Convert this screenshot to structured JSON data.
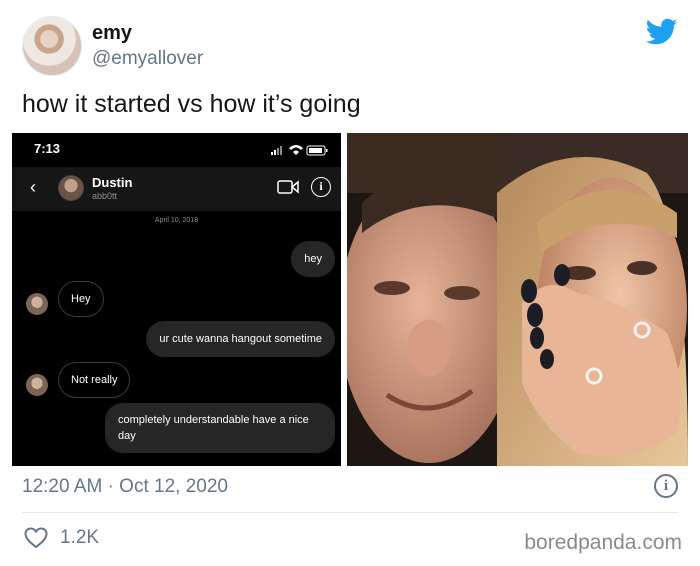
{
  "tweet": {
    "display_name": "emy",
    "handle": "@emyallover",
    "text": "how it started vs how it’s going",
    "timestamp": "12:20 AM · Oct 12, 2020",
    "likes": "1.2K",
    "brand_color": "#1da1f2"
  },
  "screenshot": {
    "status_time": "7:13",
    "contact_name": "Dustin",
    "contact_username": "abb0tt",
    "date_label": "April 10, 2018",
    "messages": [
      {
        "direction": "out",
        "text": "hey"
      },
      {
        "direction": "in",
        "text": "Hey"
      },
      {
        "direction": "out",
        "text": "ur cute wanna hangout sometime"
      },
      {
        "direction": "in",
        "text": "Not really"
      },
      {
        "direction": "out",
        "text": "completely understandable have a nice day"
      }
    ]
  },
  "photo": {
    "description_icon": "couple-selfie-photo"
  },
  "watermark": "boredpanda.com",
  "icons": {
    "twitter": "twitter-bird-icon",
    "info": "info-icon",
    "heart": "heart-icon",
    "back": "chevron-left-icon",
    "video": "video-camera-icon"
  }
}
